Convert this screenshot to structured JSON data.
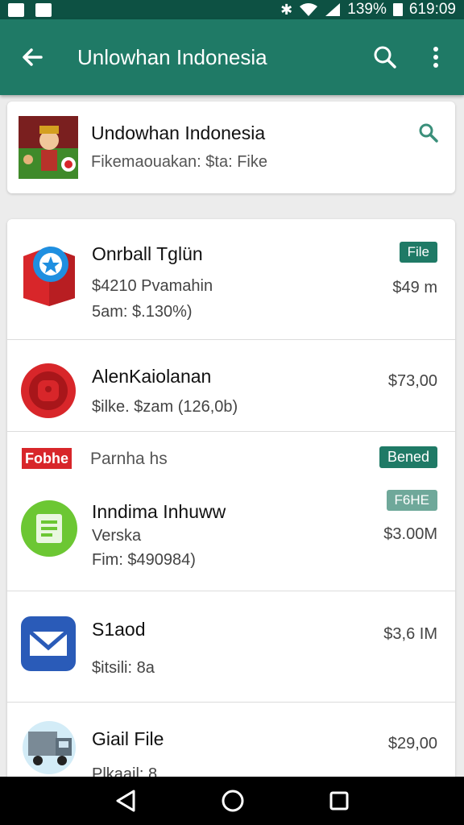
{
  "status_bar": {
    "battery": "139%",
    "time": "619:09"
  },
  "app_bar": {
    "title": "Unlowhan Indonesia"
  },
  "header_card": {
    "title": "Undowhan Indonesia",
    "subtitle": "Fikemaouakan: $ta: Fike"
  },
  "items": [
    {
      "title": "Onrball Tglün",
      "line2": "$4210 Pvamahin",
      "line3": "5am:  $.130%)",
      "price": "$49 m",
      "badge": "File"
    },
    {
      "title": "AlenKaiolanan",
      "line2": "$ilke. $zam (126,0b)",
      "price": "$73,00"
    },
    {
      "section_logo": "Fobhe",
      "section_label": "Parnha hs",
      "badge": "Bened"
    },
    {
      "title": "Inndima Inhuww",
      "line2": "Verska",
      "line3": "Fim:  $490984)",
      "price": "$3.00M",
      "badge": "F6HE"
    },
    {
      "title": "S1aod",
      "line2": "$itsili: 8a",
      "price": "$3,6 IM"
    },
    {
      "title": "Giail File",
      "line2": "Plkaail: 8",
      "price": "$29,00"
    }
  ],
  "colors": {
    "status_bar": "#0d5143",
    "app_bar": "#1f7a66",
    "badge": "#1f7a66",
    "accent_red": "#d8262a",
    "accent_green": "#6cc733",
    "accent_blue": "#2a5bb8"
  }
}
